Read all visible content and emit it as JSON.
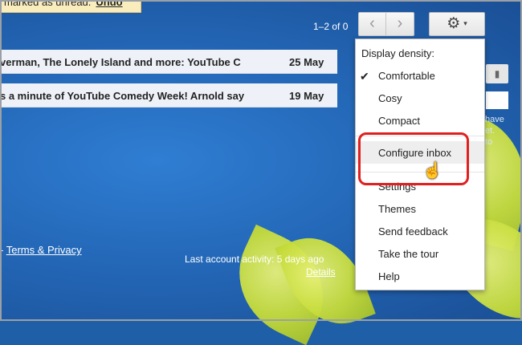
{
  "toast": {
    "message": "marked as unread.",
    "action": "Undo"
  },
  "toolbar": {
    "page_count": "1–2 of 0",
    "prev_symbol": "‹",
    "next_symbol": "›",
    "gear_symbol": "⚙",
    "caret_symbol": "▾"
  },
  "emails": [
    {
      "subject": "verman, The Lonely Island and more: YouTube C",
      "date": "25 May"
    },
    {
      "subject": "s a minute of YouTube Comedy Week! Arnold say",
      "date": "19 May"
    }
  ],
  "footer": {
    "terms_prefix": "- ",
    "terms_link": "Terms & Privacy",
    "activity": "Last account activity: 5 days ago",
    "details": "Details"
  },
  "side": {
    "cam_icon": "▮",
    "text_lines": [
      "have",
      "et.",
      "to"
    ]
  },
  "menu": {
    "header": "Display density:",
    "check_mark": "✔",
    "density": [
      "Comfortable",
      "Cosy",
      "Compact"
    ],
    "configure": "Configure inbox",
    "items": [
      "Settings",
      "Themes",
      "Send feedback",
      "Take the tour",
      "Help"
    ]
  },
  "cursor_glyph": "☝"
}
